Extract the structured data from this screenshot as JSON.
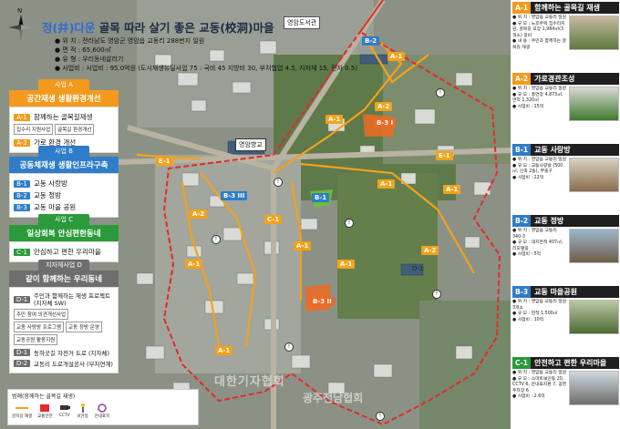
{
  "header": {
    "title_a": "정(井)다운",
    "title_b": " 골목 따라 살기 좋은 교동(校洞)마을",
    "top_badge": "영암도서관",
    "info": [
      "● 위    치 : 전라남도 영암군 영암읍 교동리 288번지 일원",
      "● 면    적 : 65,600㎡",
      "● 유    형 : 우리동네살리기",
      "● 사업비 : 사업비 : 95.0억원 (도시재생뉴딜사업 75 : 국비 45 지방비 30, 부처협업 4.5, 지자체 15, 민자 0.5)"
    ]
  },
  "sections": [
    {
      "tag": "사업 A",
      "head": "공간재생 생활환경개선",
      "color": "#f39a1d",
      "rows": [
        {
          "code": "A-1",
          "label": "함께하는 골목길재생",
          "subs": [
            "집수리 지원사업",
            "골목길 환경개선"
          ]
        },
        {
          "code": "A-2",
          "label": "가로 환경 개선",
          "subs": []
        }
      ]
    },
    {
      "tag": "사업 B",
      "head": "공동체재생 생활인프라구축",
      "color": "#2f7dc8",
      "rows": [
        {
          "code": "B-1",
          "label": "교동 사랑방",
          "subs": []
        },
        {
          "code": "B-2",
          "label": "교동 정방",
          "subs": []
        },
        {
          "code": "B-3",
          "label": "교동 마을 공원",
          "subs": []
        }
      ]
    },
    {
      "tag": "사업 C",
      "head": "일상회복 안심편한동네",
      "color": "#2a9a3a",
      "rows": [
        {
          "code": "C-1",
          "label": "안심하고 편한 우리마을",
          "subs": []
        }
      ]
    },
    {
      "tag": "지자체사업 D",
      "head": "같이 함께하는 우리동네",
      "color": "#6e6e6e",
      "rows": [
        {
          "code": "D-1",
          "label": "주민과 함께하는 재생 프로젝트 (지자체 SW)",
          "subs": [
            "주민 참여 의견개선사업",
            "교동 사랑방 프로그램",
            "교동 정방 운영",
            "교동공원 활동지원"
          ]
        },
        {
          "code": "D-1",
          "label": "동하곳길 자전거 도로 (지자체)",
          "subs": []
        },
        {
          "code": "D-2",
          "label": "교동리 도로개설공사 (부처연계)",
          "subs": []
        }
      ]
    }
  ],
  "legend": {
    "title": "범례(함께하는 골목길 재생)",
    "items": [
      "골목길 재생",
      "교통안전",
      "CCTV",
      "보안등",
      "안내표지"
    ]
  },
  "map_labels": {
    "school": "영암향교",
    "a1": "A-1",
    "a2": "A-2",
    "e1": "E-1",
    "b2": "B-2",
    "b1": "B-1",
    "b3i": "B-3 I",
    "b3ii": "B-3 II",
    "b3iii": "B-3 III",
    "c1": "C-1",
    "d1": "D-1"
  },
  "cards": [
    {
      "code": "A-1",
      "title": "함께하는 골목길 재생",
      "color": "#f39a1d",
      "text": "● 위 치 : 영암읍 교동리 일원\n● 규 모 : 노후주택 집수리지원, 골목길 포장 1,984㎡(3개소) 정비\n● 내 용 : 주민과 함께하는 골목길 재생",
      "img_top": "#c9b9a0",
      "img_bottom": "#5c7a3e"
    },
    {
      "code": "A-2",
      "title": "가로경관조성",
      "color": "#f39a1d",
      "text": "● 위 치 : 영암읍 교동리 일원\n● 규 모 : 총연장 4,873㎡, 면적 1,320㎡\n● 사업비 : 15억",
      "img_top": "#d9d9d2",
      "img_bottom": "#3f7a2f"
    },
    {
      "code": "B-1",
      "title": "교동 사랑방",
      "color": "#2f7dc8",
      "text": "● 위 치 : 영암읍 교동리 일원\n● 규 모 : 교동사랑방 (500㎡, 신축 2동), 부출구\n● 사업비 : 22억",
      "img_top": "#d8d1c2",
      "img_bottom": "#8a6d4a"
    },
    {
      "code": "B-2",
      "title": "교동 정방",
      "color": "#2f7dc8",
      "text": "● 위 치 : 영암읍 교동리 340-3\n● 규 모 : 대지면적 407㎡, 리모델링\n● 사업비 : 5억",
      "img_top": "#9bb7c9",
      "img_bottom": "#6f5e4a"
    },
    {
      "code": "B-3",
      "title": "교동 마을공원",
      "color": "#2f7dc8",
      "text": "● 위 치 : 영암읍 교동리 일원 3개소\n● 규 모 : 면적 1,500㎡\n● 사업비 : 10억",
      "img_top": "#b8c9a4",
      "img_bottom": "#4e6a33"
    },
    {
      "code": "C-1",
      "title": "안전하고 편한 우리마을",
      "color": "#2a9a3a",
      "text": "● 위 치 : 영암읍 교동리 일원\n● 규 모 : 스마트보안등 20, CCTV 6, 안내표지판 7, 공영주차장 6\n● 사업비 : 2.6억",
      "img_top": "#cfd7dd",
      "img_bottom": "#6d6d6d"
    }
  ],
  "watermark": [
    "대한기자협회",
    "광주전남협회"
  ]
}
